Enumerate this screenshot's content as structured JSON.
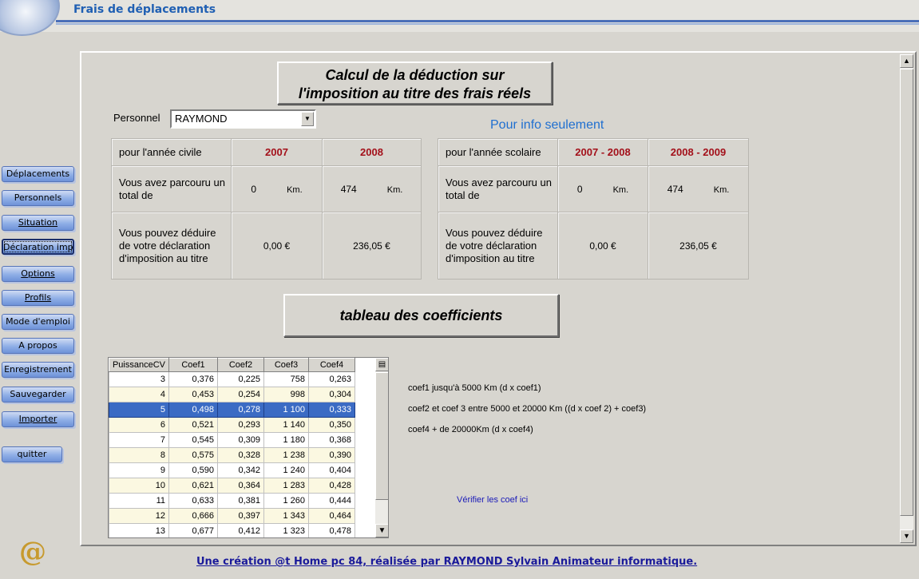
{
  "app": {
    "title": "Frais de déplacements"
  },
  "sidebar": {
    "items": [
      {
        "label": "Déplacements"
      },
      {
        "label": "Personnels"
      },
      {
        "label": "Situation"
      },
      {
        "label": "Déclaration impôt"
      },
      {
        "label": "Options"
      },
      {
        "label": "Profils"
      },
      {
        "label": "Mode d'emploi"
      },
      {
        "label": "A propos"
      },
      {
        "label": "Enregistrement"
      },
      {
        "label": "Sauvegarder"
      },
      {
        "label": "Importer"
      },
      {
        "label": "quitter"
      }
    ],
    "logo_symbol": "@"
  },
  "main": {
    "title_line1": "Calcul de la déduction sur",
    "title_line2": "l'imposition au titre des frais réels",
    "personnel_label": "Personnel",
    "personnel_value": "RAYMOND",
    "info_label": "Pour info seulement",
    "civil": {
      "header": "pour l'année civile",
      "years": [
        "2007",
        "2008"
      ],
      "row1_label": "Vous avez parcouru un total de",
      "km_values": [
        "0",
        "474"
      ],
      "km_unit": "Km.",
      "row2_label": "Vous pouvez déduire de votre déclaration d'imposition au titre",
      "deduction_values": [
        "0,00 €",
        "236,05 €"
      ]
    },
    "school": {
      "header": "pour l'année scolaire",
      "years": [
        "2007 - 2008",
        "2008 - 2009"
      ],
      "row1_label": "Vous avez parcouru un total de",
      "km_values": [
        "0",
        "474"
      ],
      "km_unit": "Km.",
      "row2_label": "Vous pouvez déduire de votre déclaration d'imposition au titre",
      "deduction_values": [
        "0,00 €",
        "236,05 €"
      ]
    },
    "coef_title": "tableau des coefficients",
    "coef_table": {
      "headers": [
        "PuissanceCV",
        "Coef1",
        "Coef2",
        "Coef3",
        "Coef4"
      ],
      "selected_row": 2,
      "rows": [
        [
          "3",
          "0,376",
          "0,225",
          "758",
          "0,263"
        ],
        [
          "4",
          "0,453",
          "0,254",
          "998",
          "0,304"
        ],
        [
          "5",
          "0,498",
          "0,278",
          "1 100",
          "0,333"
        ],
        [
          "6",
          "0,521",
          "0,293",
          "1 140",
          "0,350"
        ],
        [
          "7",
          "0,545",
          "0,309",
          "1 180",
          "0,368"
        ],
        [
          "8",
          "0,575",
          "0,328",
          "1 238",
          "0,390"
        ],
        [
          "9",
          "0,590",
          "0,342",
          "1 240",
          "0,404"
        ],
        [
          "10",
          "0,621",
          "0,364",
          "1 283",
          "0,428"
        ],
        [
          "11",
          "0,633",
          "0,381",
          "1 260",
          "0,444"
        ],
        [
          "12",
          "0,666",
          "0,397",
          "1 343",
          "0,464"
        ],
        [
          "13",
          "0,677",
          "0,412",
          "1 323",
          "0,478"
        ]
      ]
    },
    "notes": [
      "coef1 jusqu'à 5000 Km  (d x coef1)",
      "coef2 et coef 3 entre 5000 et 20000 Km ((d x coef 2) + coef3)",
      "coef4 + de 20000Km (d x coef4)"
    ],
    "verify_link": "Vérifier les coef ici"
  },
  "footer": {
    "text": "Une création @t Home pc 84, réalisée par RAYMOND Sylvain Animateur informatique."
  },
  "colors": {
    "accent": "#1f5fb3",
    "year": "#a3101a",
    "selection": "#3b6bc4",
    "info": "#1f6fd0"
  }
}
